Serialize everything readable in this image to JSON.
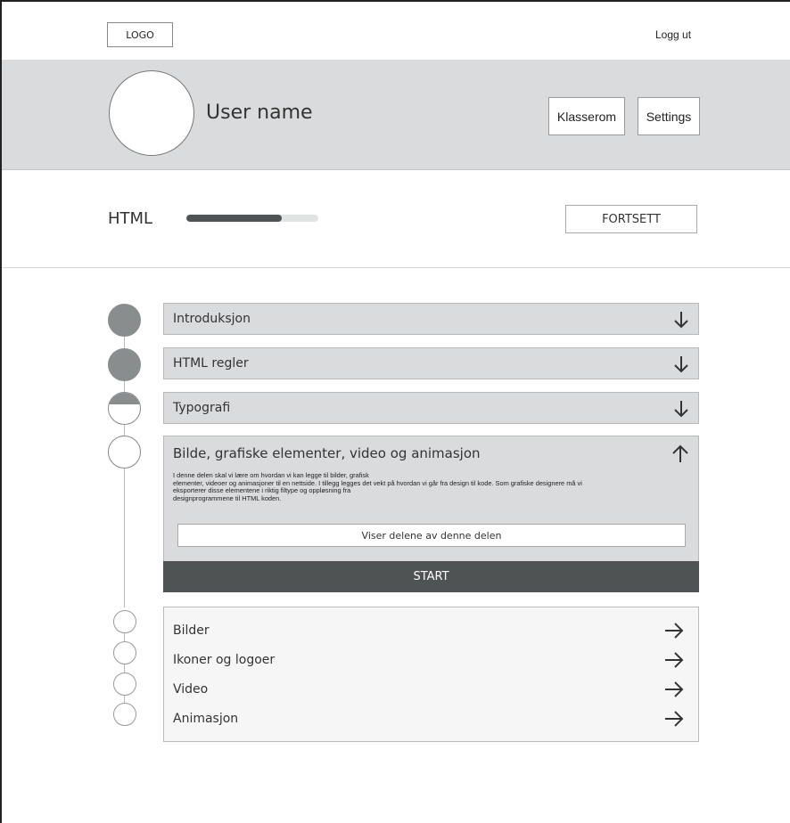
{
  "header": {
    "logo": "LOGO",
    "logout": "Logg ut"
  },
  "profile": {
    "username": "User name",
    "buttons": {
      "classroom": "Klasserom",
      "settings": "Settings"
    }
  },
  "course": {
    "title": "HTML",
    "progress": 0.72,
    "continue_label": "FORTSETT"
  },
  "modules": [
    {
      "label": "Introduksjon",
      "status": "done",
      "arrow": "arrow-down-icon"
    },
    {
      "label": "HTML regler",
      "status": "done",
      "arrow": "arrow-down-icon"
    },
    {
      "label": "Typografi",
      "status": "partial",
      "arrow": "arrow-down-icon"
    }
  ],
  "open_module": {
    "label": "Bilde, grafiske elementer, video og animasjon",
    "arrow": "arrow-up-icon",
    "description_lines": [
      "I denne delen skal vi lære om hvordan vi kan legge til bilder, grafisk",
      "elementer, videoer og animasjoner til en nettside. I tillegg legges det vekt på hvordan vi går fra design til kode. Som grafiske designere må vi",
      "eksporterer disse elementene i riktig filtype og oppløsning fra",
      "designprogrammene til HTML koden."
    ],
    "parts_label": "Viser delene av denne delen",
    "start_label": "START"
  },
  "subsections": [
    {
      "label": "Bilder",
      "arrow": "arrow-right-icon"
    },
    {
      "label": "Ikoner og logoer",
      "arrow": "arrow-right-icon"
    },
    {
      "label": "Video",
      "arrow": "arrow-right-icon"
    },
    {
      "label": "Animasjon",
      "arrow": "arrow-right-icon"
    }
  ]
}
